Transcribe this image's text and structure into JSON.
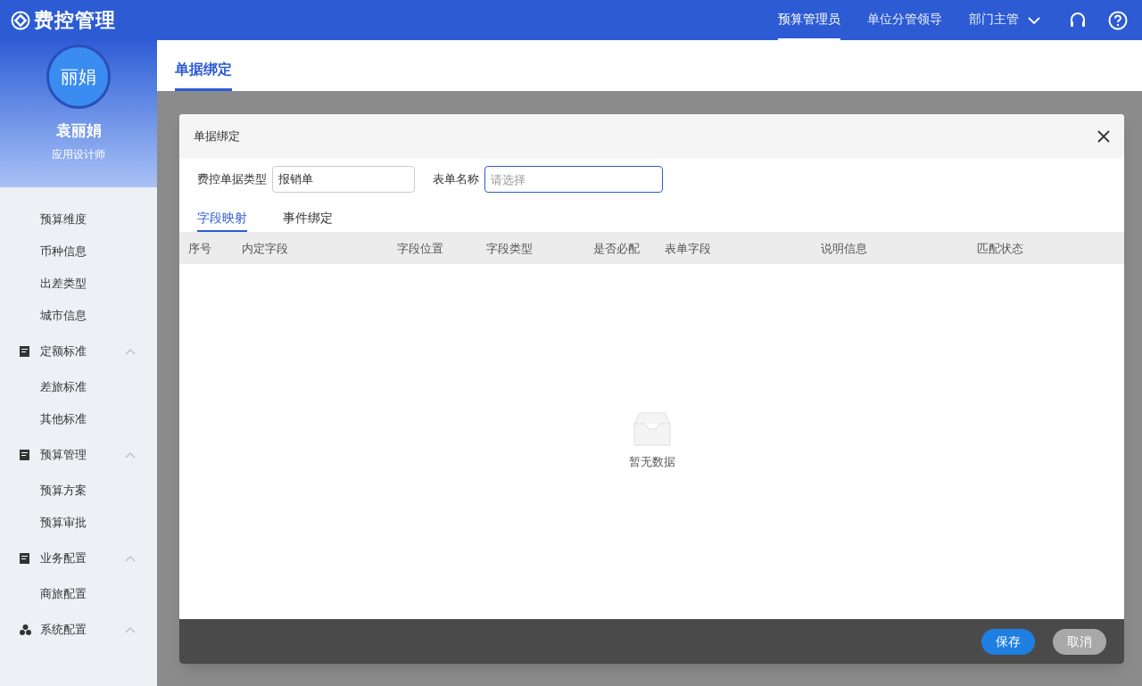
{
  "header": {
    "logo_text": "费控管理",
    "roles": [
      {
        "label": "预算管理员",
        "selected": true
      },
      {
        "label": "单位分管领导",
        "selected": false
      },
      {
        "label": "部门主管",
        "selected": false
      }
    ]
  },
  "sidebar": {
    "user": {
      "avatar_text": "丽娟",
      "name": "袁丽娟",
      "role": "应用设计师"
    },
    "menu": [
      {
        "kind": "leaf",
        "label": "预算维度"
      },
      {
        "kind": "leaf",
        "label": "币种信息"
      },
      {
        "kind": "leaf",
        "label": "出差类型"
      },
      {
        "kind": "leaf",
        "label": "城市信息"
      },
      {
        "kind": "group",
        "label": "定额标准",
        "expanded": true,
        "children": [
          {
            "label": "差旅标准"
          },
          {
            "label": "其他标准"
          }
        ]
      },
      {
        "kind": "group",
        "label": "预算管理",
        "expanded": true,
        "children": [
          {
            "label": "预算方案"
          },
          {
            "label": "预算审批"
          }
        ]
      },
      {
        "kind": "group",
        "label": "业务配置",
        "expanded": true,
        "children": [
          {
            "label": "商旅配置"
          }
        ]
      },
      {
        "kind": "group",
        "label": "系统配置",
        "expanded": true
      }
    ]
  },
  "page_tabs": [
    {
      "label": "单据绑定",
      "selected": true
    }
  ],
  "modal": {
    "title": "单据绑定",
    "fields": [
      {
        "label": "费控单据类型",
        "value": "报销单",
        "focused": false
      },
      {
        "label": "表单名称",
        "placeholder": "请选择",
        "focused": true
      }
    ],
    "tabs": [
      {
        "label": "字段映射",
        "selected": true
      },
      {
        "label": "事件绑定",
        "selected": false
      }
    ],
    "table": {
      "columns": [
        "序号",
        "内定字段",
        "字段位置",
        "字段类型",
        "是否必配",
        "表单字段",
        "说明信息",
        "匹配状态"
      ],
      "empty_text": "暂无数据"
    },
    "buttons": [
      {
        "label": "保存",
        "kind": "primary"
      },
      {
        "label": "取消",
        "kind": "secondary"
      }
    ]
  }
}
